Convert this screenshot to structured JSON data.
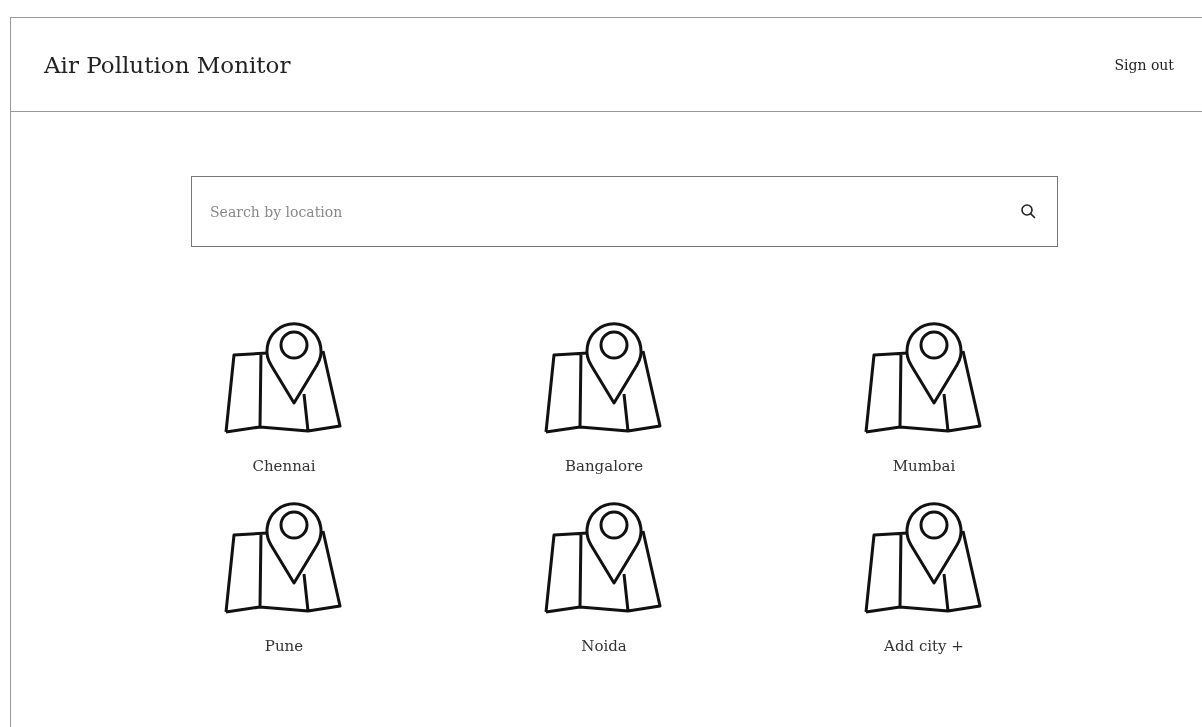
{
  "header": {
    "title": "Air Pollution Monitor",
    "sign_out": "Sign out"
  },
  "search": {
    "placeholder": "Search by location"
  },
  "cities": [
    {
      "label": "Chennai"
    },
    {
      "label": "Bangalore"
    },
    {
      "label": "Mumbai"
    },
    {
      "label": "Pune"
    },
    {
      "label": "Noida"
    },
    {
      "label": "Add city +"
    }
  ]
}
